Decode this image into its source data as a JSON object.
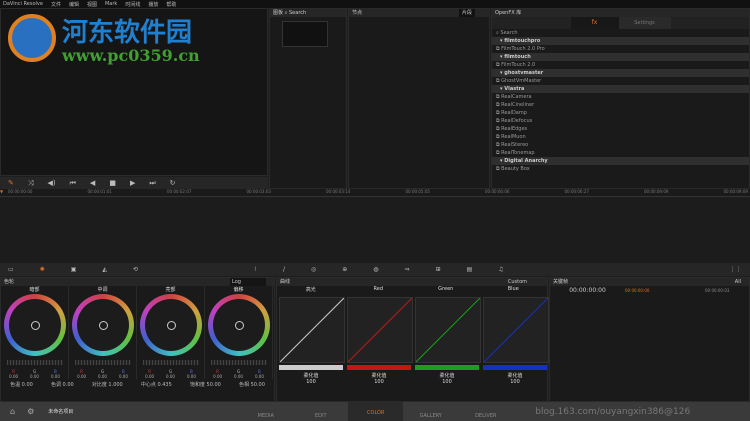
{
  "menu": [
    "DaVinci Resolve",
    "文件",
    "编辑",
    "视图",
    "Mark",
    "时间线",
    "播放",
    "帮助"
  ],
  "gallery": {
    "title": "图板",
    "search": "Search"
  },
  "nodes": {
    "title": "节点",
    "mode": "片段"
  },
  "openfx": {
    "title": "OpenFX 库",
    "tabs": [
      "fx",
      "Settings"
    ],
    "search": "Search",
    "list": [
      {
        "g": "filmtouchpro"
      },
      {
        "i": "FilmTouch 2.0 Pro"
      },
      {
        "g": "filmtouch"
      },
      {
        "i": "FilmTouch 2.0"
      },
      {
        "g": "ghostvmaster"
      },
      {
        "i": "GhostVmMaster"
      },
      {
        "g": "Vlastra"
      },
      {
        "i": "RealCamera"
      },
      {
        "i": "RealCineliner"
      },
      {
        "i": "RealDamp"
      },
      {
        "i": "RealDefocus"
      },
      {
        "i": "RealEdges"
      },
      {
        "i": "RealMuon"
      },
      {
        "i": "RealStereo"
      },
      {
        "i": "RealTonemap"
      },
      {
        "g": "Digital Anarchy"
      },
      {
        "i": "Beauty Box"
      }
    ]
  },
  "timeline": {
    "ticks": [
      "00:00:00:00",
      "00:00:01:01",
      "00:00:02:07",
      "00:00:03:03",
      "00:00:03:14",
      "00:00:05:05",
      "00:00:06:06",
      "00:00:06:27",
      "00:00:09:09",
      "00:00:09:09"
    ]
  },
  "wheels": {
    "title": "色轮",
    "mode": "Log",
    "items": [
      {
        "label": "暗部",
        "vals": [
          "0.00",
          "0.00",
          "0.00"
        ]
      },
      {
        "label": "中调",
        "vals": [
          "0.00",
          "0.00",
          "0.00"
        ]
      },
      {
        "label": "亮部",
        "vals": [
          "0.00",
          "0.00",
          "0.00"
        ]
      },
      {
        "label": "偏移",
        "vals": [
          "0.00",
          "0.00",
          "0.00"
        ]
      }
    ],
    "rgb": [
      "R",
      "G",
      "B"
    ],
    "params": [
      {
        "k": "色温",
        "v": "0.00"
      },
      {
        "k": "色调",
        "v": "0.00"
      },
      {
        "k": "对比度",
        "v": "1.000"
      },
      {
        "k": "中心点",
        "v": "0.435"
      },
      {
        "k": "饱和度",
        "v": "50.00"
      },
      {
        "k": "色相",
        "v": "50.00"
      }
    ]
  },
  "curves": {
    "title": "曲线",
    "mode": "Custom",
    "channels": [
      {
        "label": "高光",
        "color": "#cccccc",
        "soft": "柔化值",
        "v": "100"
      },
      {
        "label": "Red",
        "color": "#c01818",
        "soft": "柔化值",
        "v": "100"
      },
      {
        "label": "Green",
        "color": "#18a018",
        "soft": "柔化值",
        "v": "100"
      },
      {
        "label": "Blue",
        "color": "#1830c0",
        "soft": "柔化值",
        "v": "100"
      }
    ]
  },
  "keyframes": {
    "title": "关键帧",
    "mode": "All",
    "tc": "00:00:00:00",
    "tc2": "00:00:00:00",
    "tc3": "00:00:00:03"
  },
  "project": "未命名项目",
  "tabs": [
    "MEDIA",
    "EDIT",
    "COLOR",
    "GALLERY",
    "DELIVER"
  ],
  "watermark": {
    "site": "河东软件园",
    "url": "www.pc0359.cn",
    "blog": "blog.163.com/ouyangxin386@126"
  },
  "accent": "#e07020"
}
